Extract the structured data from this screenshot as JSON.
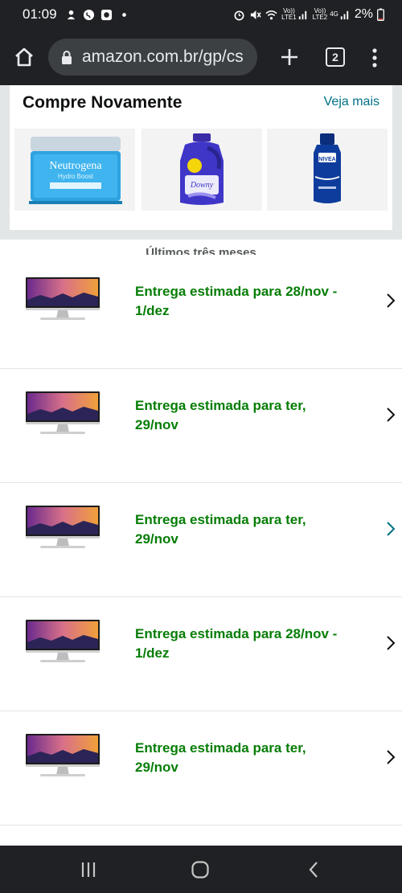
{
  "status_bar": {
    "time": "01:09",
    "net1_top": "Vo))",
    "net1_bottom": "LTE1",
    "net2_top": "Vo))",
    "net2_bottom": "LTE2",
    "net2_type": "4G",
    "battery": "2%"
  },
  "browser": {
    "url": "amazon.com.br/gp/cs",
    "tab_count": "2"
  },
  "buy_again": {
    "title": "Compre Novamente",
    "see_more": "Veja mais",
    "products": [
      {
        "icon": "moisturizer-jar-icon",
        "brand": "Neutrogena",
        "line": "Hydro Boost"
      },
      {
        "icon": "fabric-softener-bottle-icon",
        "brand": "Downy"
      },
      {
        "icon": "body-lotion-bottle-icon",
        "brand": "NIVEA"
      }
    ]
  },
  "section_header": "Últimos três meses",
  "orders": [
    {
      "line1": "Entrega estimada para 28/nov -",
      "line2": "1/dez",
      "icon": "monitor-icon"
    },
    {
      "line1": "Entrega estimada para ter,",
      "line2": "29/nov",
      "icon": "monitor-icon"
    },
    {
      "line1": "Entrega estimada para ter,",
      "line2": "29/nov",
      "icon": "monitor-icon"
    },
    {
      "line1": "Entrega estimada para 28/nov -",
      "line2": "1/dez",
      "icon": "monitor-icon"
    },
    {
      "line1": "Entrega estimada para ter,",
      "line2": "29/nov",
      "icon": "monitor-icon"
    }
  ],
  "colors": {
    "delivery_green": "#067d06",
    "link_teal": "#007185",
    "chrome_dark": "#202124"
  }
}
